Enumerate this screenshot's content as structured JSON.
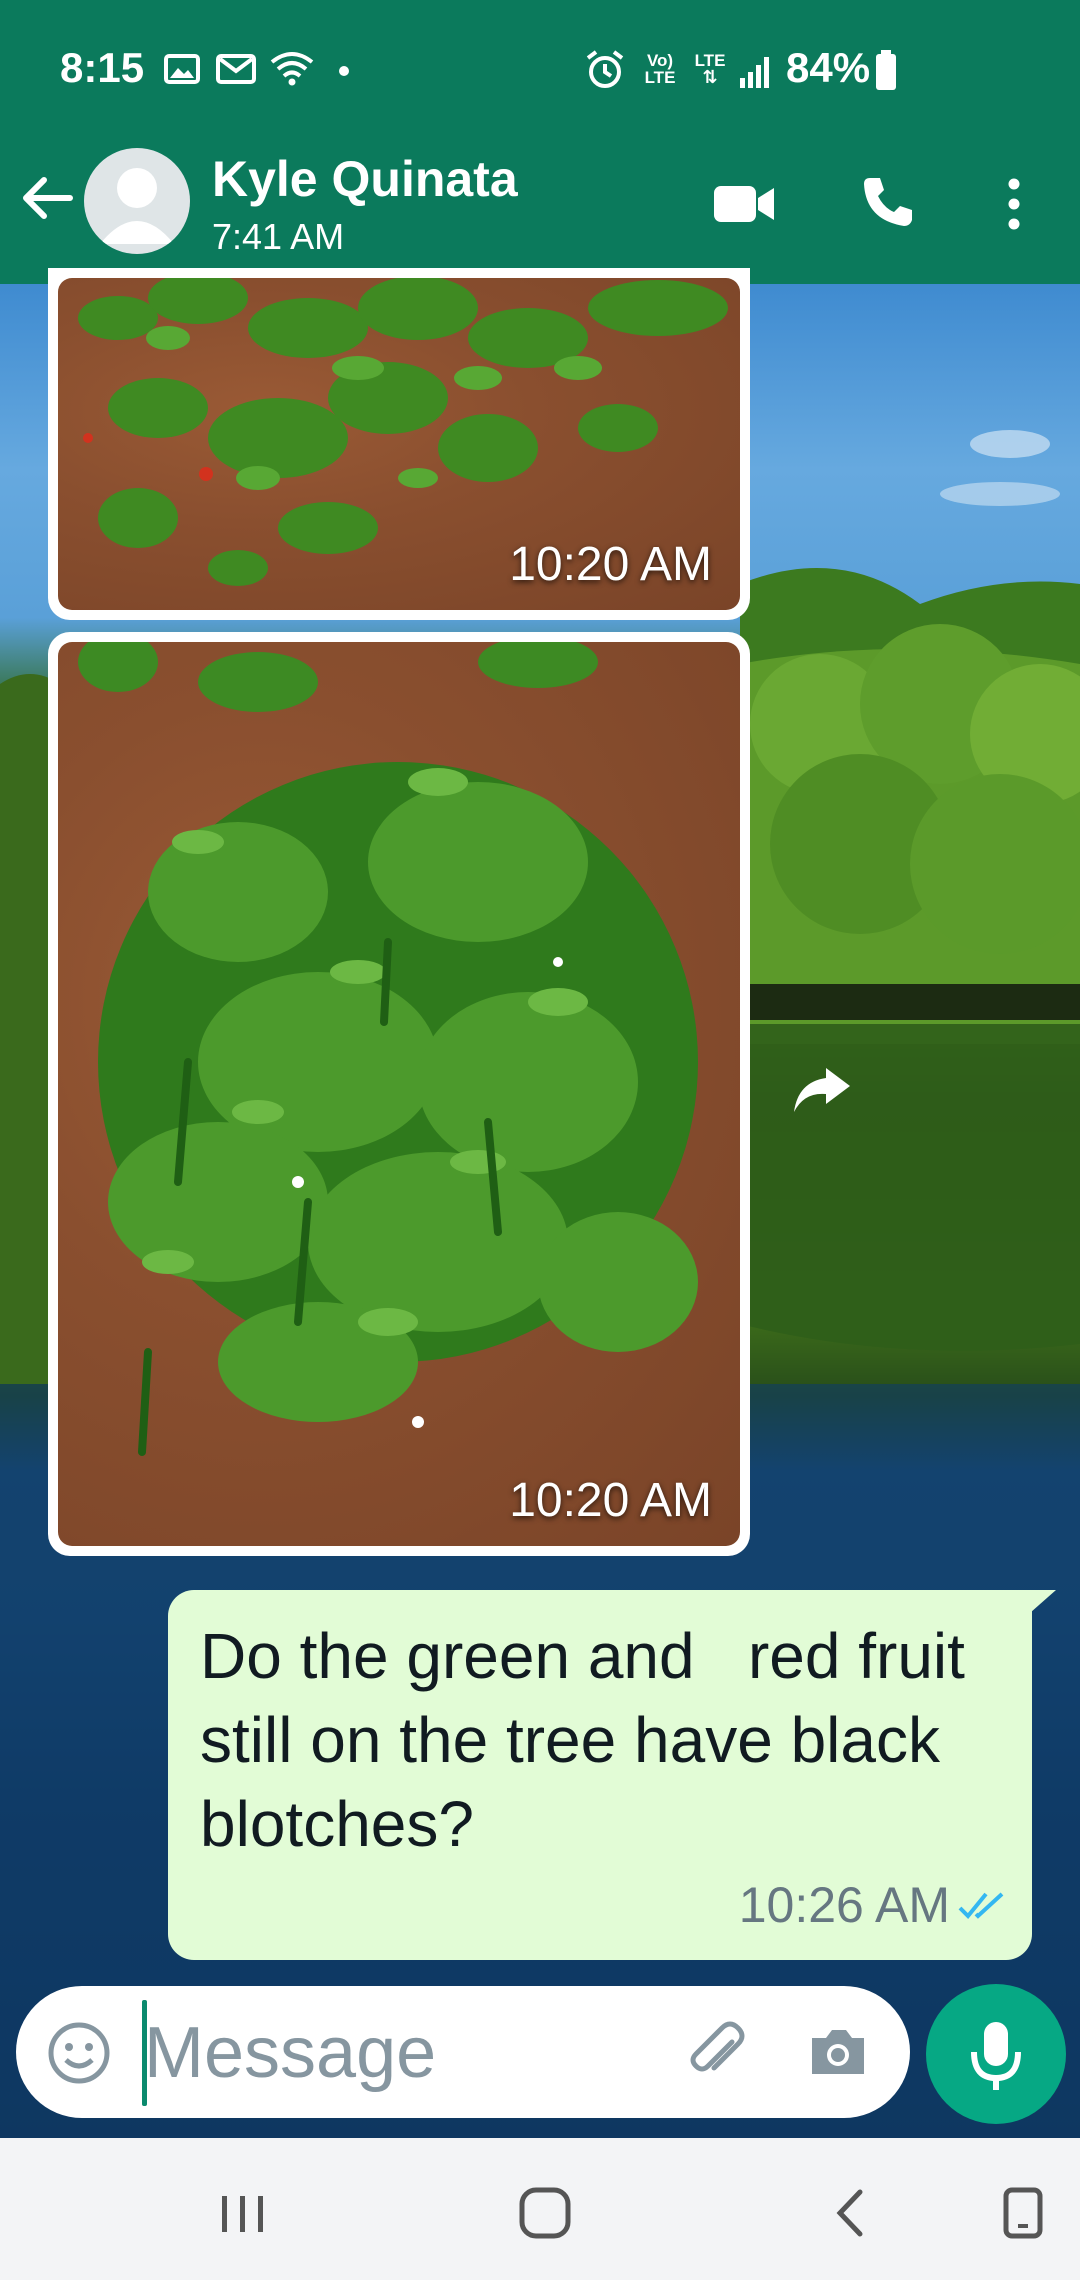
{
  "status_bar": {
    "time": "8:15",
    "battery": "84%",
    "network_top": "Vo)",
    "network_bottom": "LTE",
    "lte_label": "LTE",
    "icons": [
      "image-icon",
      "mail-icon",
      "wifi-icon",
      "dot-icon",
      "alarm-icon",
      "volte-icon",
      "lte-icon",
      "signal-icon",
      "battery-icon"
    ]
  },
  "header": {
    "contact_name": "Kyle Quinata",
    "last_seen": "7:41 AM",
    "icons": [
      "back-arrow-icon",
      "avatar-icon",
      "video-call-icon",
      "phone-icon",
      "more-vert-icon"
    ]
  },
  "messages": [
    {
      "type": "image",
      "direction": "incoming",
      "time": "10:20 AM",
      "subject": "pepper plants in soil"
    },
    {
      "type": "image",
      "direction": "incoming",
      "time": "10:20 AM",
      "subject": "pepper plant with green peppers"
    },
    {
      "type": "text",
      "direction": "outgoing",
      "text": "Do the green and   red fruit still on the tree have black blotches?",
      "time": "10:26 AM",
      "status": "read"
    }
  ],
  "composer": {
    "placeholder": "Message",
    "icons": [
      "emoji-icon",
      "attach-icon",
      "camera-icon",
      "mic-icon"
    ]
  },
  "nav_bar": {
    "icons": [
      "recents-icon",
      "home-icon",
      "back-icon",
      "rotate-icon"
    ]
  },
  "colors": {
    "header": "#0b7a5c",
    "outgoing_bubble": "#e2fcd6",
    "mic_button": "#06a884",
    "read_ticks": "#34b7f1"
  }
}
